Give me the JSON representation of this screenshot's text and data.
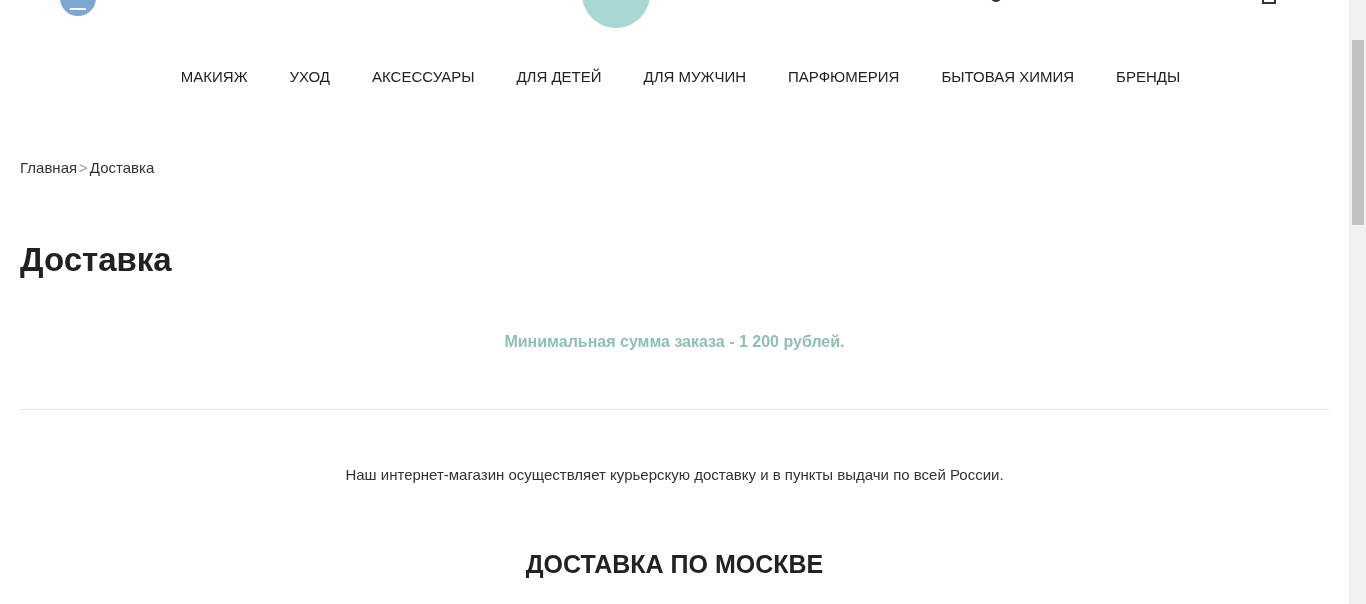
{
  "nav": [
    {
      "label": "МАКИЯЖ"
    },
    {
      "label": "УХОД"
    },
    {
      "label": "АКСЕССУАРЫ"
    },
    {
      "label": "ДЛЯ ДЕТЕЙ"
    },
    {
      "label": "ДЛЯ МУЖЧИН"
    },
    {
      "label": "ПАРФЮМЕРИЯ"
    },
    {
      "label": "БЫТОВАЯ ХИМИЯ"
    },
    {
      "label": "БРЕНДЫ"
    }
  ],
  "breadcrumbs": [
    {
      "label": "Главная"
    },
    {
      "label": "Доставка"
    }
  ],
  "breadcrumb_separator": ">",
  "title": "Доставка",
  "notice": "Минимальная сумма заказа - 1 200 рублей.",
  "intro": "Наш интернет-магазин осуществляет курьерскую доставку и в пункты выдачи по всей России.",
  "section_heading": "ДОСТАВКА ПО МОСКВЕ"
}
